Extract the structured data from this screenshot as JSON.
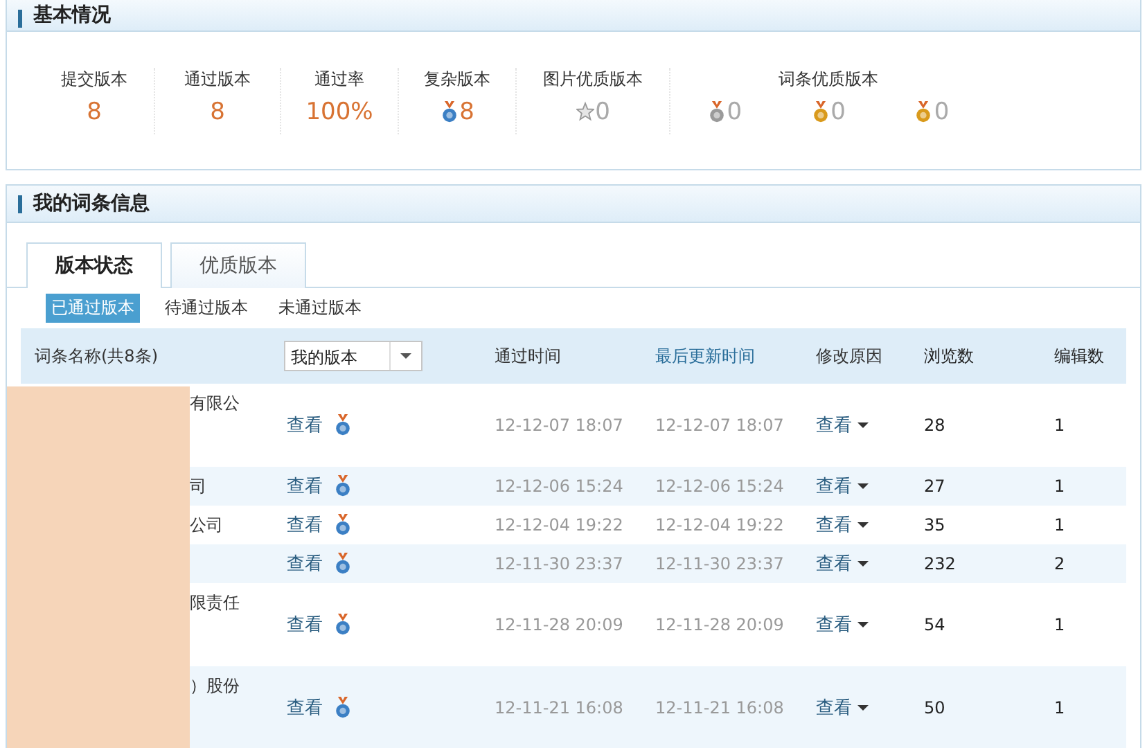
{
  "basic_section": {
    "title": "基本情况"
  },
  "stats": [
    {
      "kind": "plain",
      "label": "提交版本",
      "value": "8"
    },
    {
      "kind": "plain",
      "label": "通过版本",
      "value": "8"
    },
    {
      "kind": "plain",
      "label": "通过率",
      "value": "100%"
    },
    {
      "kind": "medal",
      "color": "#3b7fc4",
      "label": "复杂版本",
      "value": "8",
      "dim": false
    },
    {
      "kind": "star",
      "label": "图片优质版本",
      "value": "0",
      "dim": true
    },
    {
      "kind": "group",
      "label": "词条优质版本",
      "items": [
        {
          "color": "#9a9a9a",
          "value": "0",
          "dim": true
        },
        {
          "color": "#d99a1c",
          "value": "0",
          "dim": true
        },
        {
          "color": "#d99a1c",
          "value": "0",
          "dim": true
        }
      ]
    }
  ],
  "entries_section": {
    "title": "我的词条信息"
  },
  "tabs": [
    {
      "label": "版本状态",
      "selected": true
    },
    {
      "label": "优质版本",
      "selected": false
    }
  ],
  "filters": [
    {
      "label": "已通过版本",
      "selected": true
    },
    {
      "label": "待通过版本",
      "selected": false
    },
    {
      "label": "未通过版本",
      "selected": false
    }
  ],
  "table": {
    "columns": [
      {
        "kind": "text",
        "label": "词条名称(共8条)",
        "link": false
      },
      {
        "kind": "dropdown",
        "label": "我的版本"
      },
      {
        "kind": "text",
        "label": "通过时间",
        "link": false
      },
      {
        "kind": "text",
        "label": "最后更新时间",
        "link": true
      },
      {
        "kind": "text",
        "label": "修改原因",
        "link": false
      },
      {
        "kind": "text",
        "label": "浏览数",
        "link": false
      },
      {
        "kind": "text",
        "label": "编辑数",
        "link": false
      }
    ],
    "rows": [
      {
        "name": "有限公",
        "tall": true,
        "view": "查看",
        "passed": "12-12-07 18:07",
        "updated": "12-12-07 18:07",
        "reason": "查看",
        "views": "28",
        "edits": "1"
      },
      {
        "name": "司",
        "tall": false,
        "view": "查看",
        "passed": "12-12-06 15:24",
        "updated": "12-12-06 15:24",
        "reason": "查看",
        "views": "27",
        "edits": "1"
      },
      {
        "name": "公司",
        "tall": false,
        "view": "查看",
        "passed": "12-12-04 19:22",
        "updated": "12-12-04 19:22",
        "reason": "查看",
        "views": "35",
        "edits": "1"
      },
      {
        "tall": false,
        "view": "查看",
        "passed": "12-11-30 23:37",
        "updated": "12-11-30 23:37",
        "reason": "查看",
        "views": "232",
        "edits": "2"
      },
      {
        "name": "限责任",
        "tall": true,
        "view": "查看",
        "passed": "12-11-28 20:09",
        "updated": "12-11-28 20:09",
        "reason": "查看",
        "views": "54",
        "edits": "1"
      },
      {
        "name": "）股份",
        "tall": true,
        "view": "查看",
        "passed": "12-11-21 16:08",
        "updated": "12-11-21 16:08",
        "reason": "查看",
        "views": "50",
        "edits": "1"
      }
    ]
  }
}
